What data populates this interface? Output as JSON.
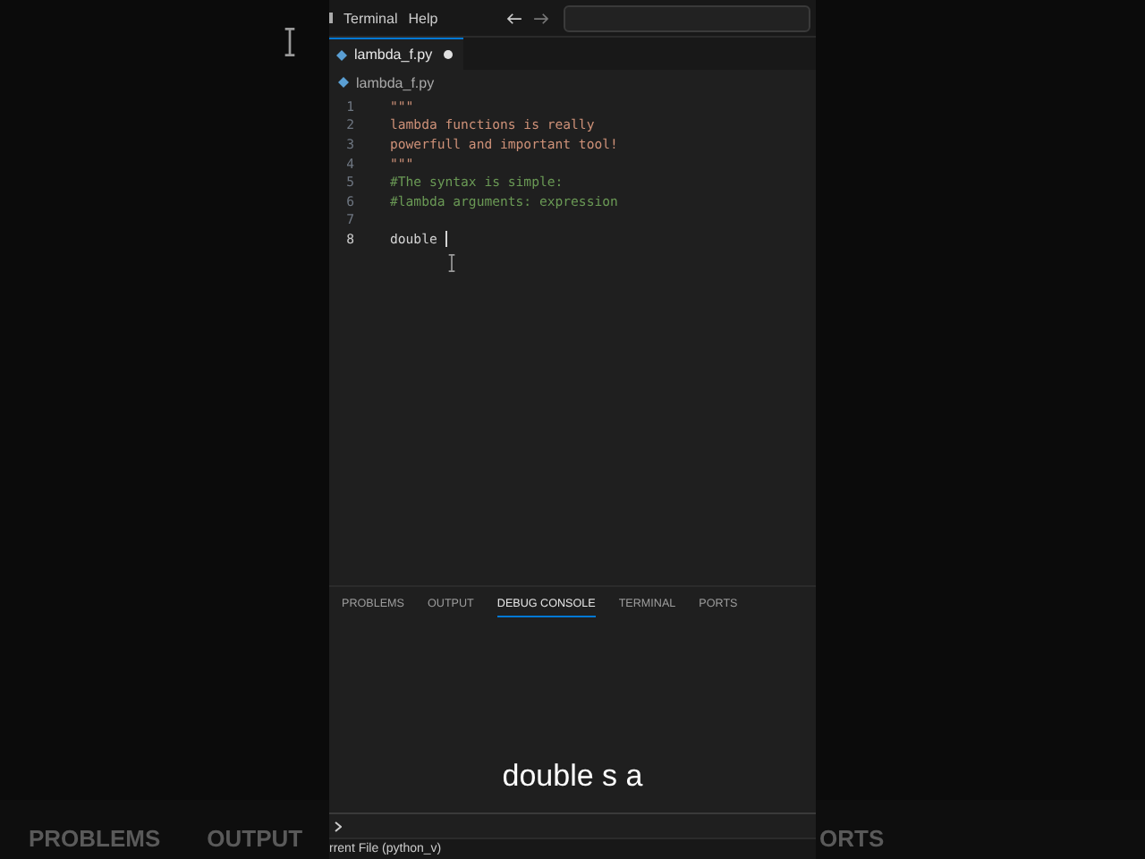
{
  "background": {
    "left_tabs": [
      "PROBLEMS",
      "OUTPUT"
    ],
    "right_tabs": [
      "ORTS"
    ]
  },
  "menu_bar": {
    "items": [
      "Terminal",
      "Help"
    ]
  },
  "tabs": [
    {
      "label": "lambda_f.py",
      "selected": true,
      "modified": true
    }
  ],
  "breadcrumb": "lambda_f.py",
  "editor": {
    "lines": [
      {
        "number": "1",
        "text": "\"\"\"",
        "kind": "string",
        "active": false
      },
      {
        "number": "2",
        "text": "lambda functions is really",
        "kind": "string",
        "active": false
      },
      {
        "number": "3",
        "text": "powerfull and important tool!",
        "kind": "string",
        "active": false
      },
      {
        "number": "4",
        "text": "\"\"\"",
        "kind": "string",
        "active": false
      },
      {
        "number": "5",
        "text": "#The syntax is simple:",
        "kind": "comment",
        "active": false
      },
      {
        "number": "6",
        "text": "#lambda arguments: expression",
        "kind": "comment",
        "active": false
      },
      {
        "number": "7",
        "kind": "code",
        "active": false
      },
      {
        "number": "8",
        "text": "double ",
        "kind": "code",
        "active": true
      }
    ]
  },
  "panel": {
    "tabs": [
      {
        "label": "PROBLEMS",
        "selected": false
      },
      {
        "label": "OUTPUT",
        "selected": false
      },
      {
        "label": "DEBUG CONSOLE",
        "selected": true
      },
      {
        "label": "TERMINAL",
        "selected": false
      },
      {
        "label": "PORTS",
        "selected": false
      }
    ]
  },
  "caption": "double s a",
  "status_bar": {
    "text": "rrent File (python_v)"
  }
}
